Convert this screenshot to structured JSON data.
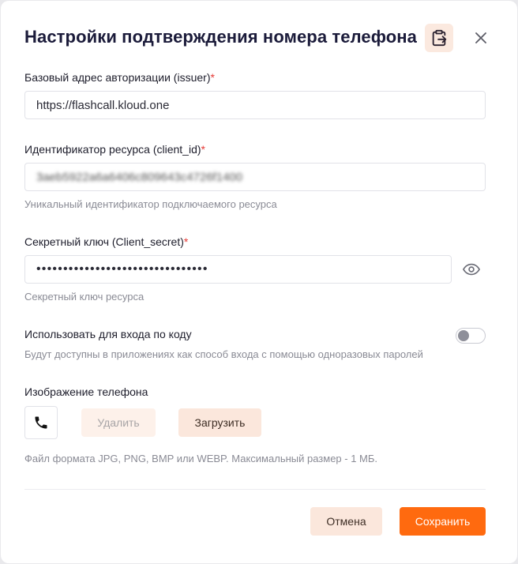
{
  "dialog": {
    "title": "Настройки подтверждения номера телефона",
    "icons": {
      "paste": "clipboard-paste-icon",
      "close": "close-icon"
    }
  },
  "issuer": {
    "label": "Базовый адрес авторизации (issuer)",
    "required_mark": "*",
    "value": "https://flashcall.kloud.one"
  },
  "client_id": {
    "label": "Идентификатор ресурса (client_id)",
    "required_mark": "*",
    "value": "3aeb5922a6a6406c809643c4726f1400",
    "hint": "Уникальный идентификатор подключаемого ресурса"
  },
  "client_secret": {
    "label": "Секретный ключ (Client_secret)",
    "required_mark": "*",
    "value": "••••••••••••••••••••••••••••••••",
    "hint": "Секретный ключ ресурса",
    "visibility_icon": "eye-icon"
  },
  "login_by_code": {
    "label": "Использовать для входа по коду",
    "hint": "Будут доступны в приложениях как способ входа с помощью одноразовых паролей",
    "enabled": false
  },
  "phone_image": {
    "label": "Изображение телефона",
    "icon": "phone-icon",
    "delete_label": "Удалить",
    "upload_label": "Загрузить",
    "hint": "Файл формата JPG, PNG, BMP или WEBP. Максимальный размер - 1 МБ."
  },
  "footer": {
    "cancel_label": "Отмена",
    "save_label": "Сохранить"
  },
  "colors": {
    "accent": "#ff6a0f",
    "accent_soft": "#fbe7dc",
    "required": "#e53935"
  }
}
